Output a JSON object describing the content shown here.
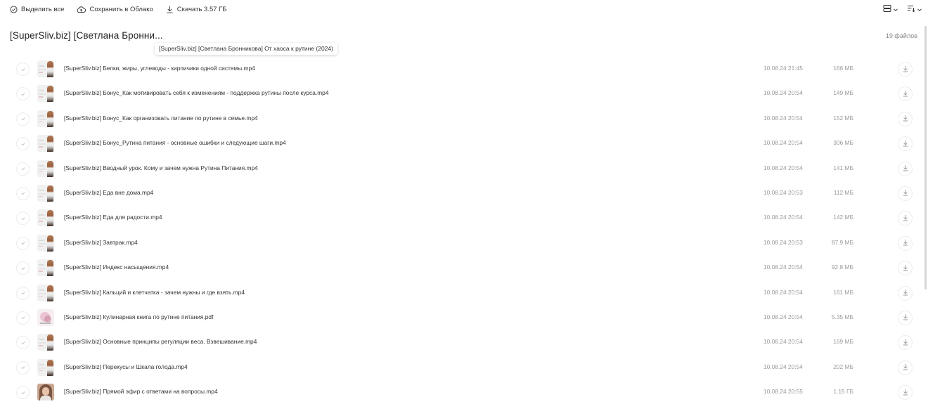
{
  "toolbar": {
    "select_all": "Выделить все",
    "save_cloud": "Сохранить в Облако",
    "download": "Скачать 3.57 ГБ",
    "view_mode_icon": "list-view-icon",
    "sort_icon": "sort-icon"
  },
  "folder": {
    "title": "[SuperSliv.biz] [Светлана Бронни...",
    "tooltip": "[SuperSliv.biz] [Светлана Бронникова] От хаоса к рутине (2024)",
    "count": "19 файлов"
  },
  "files": [
    {
      "name": "[SuperSliv.biz] Белки, жиры, углеводы - кирпичики одной системы.mp4",
      "date": "10.08.24 21:45",
      "size": "166 МБ",
      "thumb": "video"
    },
    {
      "name": "[SuperSliv.biz] Бонус_Как мотивировать себя к изменениям - поддержка рутины после курса.mp4",
      "date": "10.08.24 20:54",
      "size": "149 МБ",
      "thumb": "video"
    },
    {
      "name": "[SuperSliv.biz] Бонус_Как организовать питание по рутине в семье.mp4",
      "date": "10.08.24 20:54",
      "size": "152 МБ",
      "thumb": "video"
    },
    {
      "name": "[SuperSliv.biz] Бонус_Рутина питания - основные ошибки и следующие шаги.mp4",
      "date": "10.08.24 20:54",
      "size": "306 МБ",
      "thumb": "video"
    },
    {
      "name": "[SuperSliv.biz] Вводный урок. Кому и зачем нужна Рутина Питания.mp4",
      "date": "10.08.24 20:54",
      "size": "141 МБ",
      "thumb": "video"
    },
    {
      "name": "[SuperSliv.biz] Еда вне дома.mp4",
      "date": "10.08.24 20:53",
      "size": "112 МБ",
      "thumb": "video"
    },
    {
      "name": "[SuperSliv.biz] Еда для радости.mp4",
      "date": "10.08.24 20:54",
      "size": "142 МБ",
      "thumb": "video"
    },
    {
      "name": "[SuperSliv.biz] Завтрак.mp4",
      "date": "10.08.24 20:53",
      "size": "87.9 МБ",
      "thumb": "video"
    },
    {
      "name": "[SuperSliv.biz] Индекс насыщения.mp4",
      "date": "10.08.24 20:54",
      "size": "92.8 МБ",
      "thumb": "video"
    },
    {
      "name": "[SuperSliv.biz] Кальций и клетчатка - зачем нужны и где взять.mp4",
      "date": "10.08.24 20:54",
      "size": "161 МБ",
      "thumb": "video"
    },
    {
      "name": "[SuperSliv.biz] Кулинарная книга по рутине питания.pdf",
      "date": "10.08.24 20:54",
      "size": "5.35 МБ",
      "thumb": "pdf"
    },
    {
      "name": "[SuperSliv.biz] Основные принципы регуляции веса. Взвешивание.mp4",
      "date": "10.08.24 20:54",
      "size": "169 МБ",
      "thumb": "video"
    },
    {
      "name": "[SuperSliv.biz] Перекусы и Шкала голода.mp4",
      "date": "10.08.24 20:54",
      "size": "202 МБ",
      "thumb": "video"
    },
    {
      "name": "[SuperSliv.biz] Прямой эфир с ответами на вопросы.mp4",
      "date": "10.08.24 20:55",
      "size": "1.15 ГБ",
      "thumb": "photo"
    }
  ]
}
